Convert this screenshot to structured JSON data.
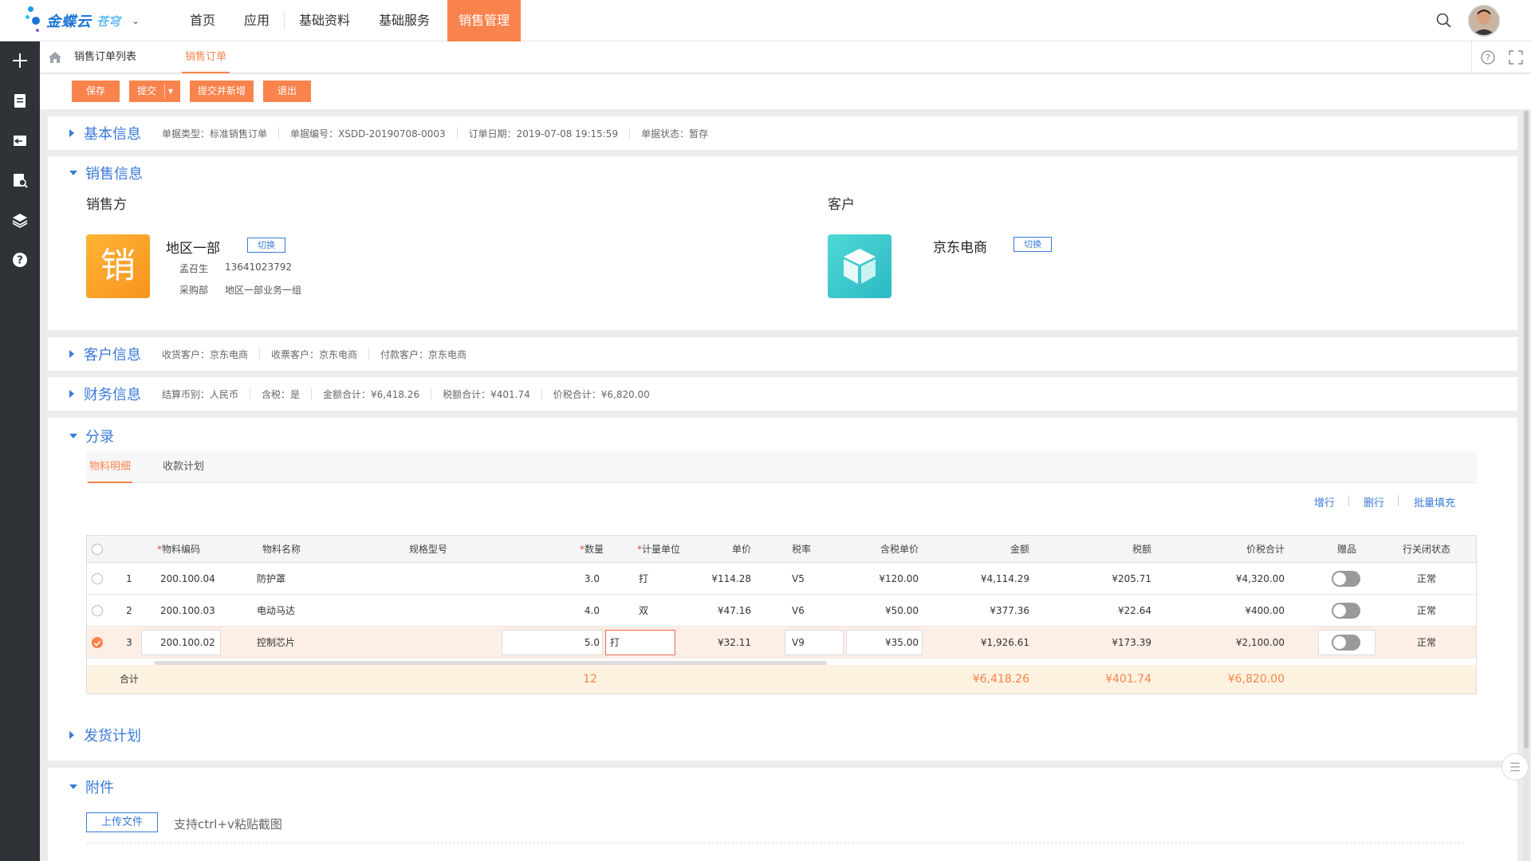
{
  "brand": {
    "name": "金蝶云",
    "sub": "苍穹"
  },
  "nav": [
    "首页",
    "应用",
    "基础资料",
    "基础服务",
    "销售管理"
  ],
  "tabs": [
    "销售订单列表",
    "销售订单"
  ],
  "toolbar": {
    "save": "保存",
    "submit": "提交",
    "submit_new": "提交并新增",
    "exit": "退出"
  },
  "basic": {
    "title": "基本信息",
    "bill_type": "单据类型：标准销售订单",
    "bill_no": "单据编号：XSDD-20190708-0003",
    "order_date": "订单日期：2019-07-08 19:15:59",
    "bill_status": "单据状态：暂存"
  },
  "sales": {
    "title": "销售信息",
    "seller_label": "销售方",
    "seller_icon_char": "销",
    "seller_name": "地区一部",
    "seller_person": "孟召生",
    "seller_phone": "13641023792",
    "seller_dept_label": "采购部",
    "seller_dept": "地区一部业务一组",
    "customer_label": "客户",
    "customer_name": "京东电商",
    "switch": "切换"
  },
  "customer": {
    "title": "客户信息",
    "receive": "收货客户：京东电商",
    "invoice": "收票客户：京东电商",
    "payer": "付款客户：京东电商"
  },
  "finance": {
    "title": "财务信息",
    "currency": "结算币别：人民币",
    "tax_incl": "含税：是",
    "amount": "金额合计：¥6,418.26",
    "tax": "税额合计：¥401.74",
    "total": "价税合计：¥6,820.00"
  },
  "entries": {
    "title": "分录",
    "subtabs": [
      "物料明细",
      "收款计划"
    ],
    "actions": [
      "增行",
      "删行",
      "批量填充"
    ],
    "headers": [
      "物料编码",
      "物料名称",
      "规格型号",
      "数量",
      "计量单位",
      "单价",
      "税率",
      "含税单价",
      "金额",
      "税额",
      "价税合计",
      "赠品",
      "行关闭状态"
    ],
    "rows": [
      {
        "no": "1",
        "code": "200.100.04",
        "name": "防护罩",
        "qty": "3.0",
        "unit": "打",
        "price": "¥114.28",
        "tax_rate": "V5",
        "price_tax": "¥120.00",
        "amount": "¥4,114.29",
        "tax": "¥205.71",
        "total": "¥4,320.00",
        "status": "正常"
      },
      {
        "no": "2",
        "code": "200.100.03",
        "name": "电动马达",
        "qty": "4.0",
        "unit": "双",
        "price": "¥47.16",
        "tax_rate": "V6",
        "price_tax": "¥50.00",
        "amount": "¥377.36",
        "tax": "¥22.64",
        "total": "¥400.00",
        "status": "正常"
      },
      {
        "no": "3",
        "code": "200.100.02",
        "name": "控制芯片",
        "qty": "5.0",
        "unit": "打",
        "price": "¥32.11",
        "tax_rate": "V9",
        "price_tax": "¥35.00",
        "amount": "¥1,926.61",
        "tax": "¥173.39",
        "total": "¥2,100.00",
        "status": "正常"
      }
    ],
    "summary": {
      "label": "合计",
      "qty": "12",
      "amount": "¥6,418.26",
      "tax": "¥401.74",
      "total": "¥6,820.00"
    }
  },
  "delivery": {
    "title": "发货计划"
  },
  "attachment": {
    "title": "附件",
    "upload": "上传文件",
    "hint": "支持ctrl+v粘贴截图"
  },
  "colors": {
    "accent": "#f9834c",
    "link": "#3b7ad8",
    "sidebar": "#2f3237"
  }
}
